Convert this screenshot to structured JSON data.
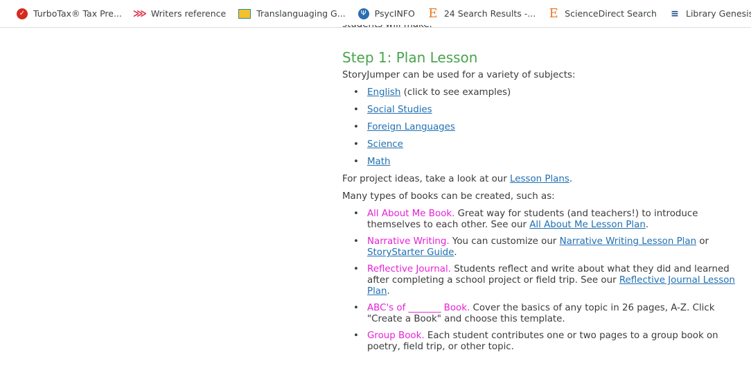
{
  "bookmarks": [
    {
      "label": "TurboTax® Tax Pre...",
      "icon": "turbotax-icon"
    },
    {
      "label": "Writers reference",
      "icon": "writers-reference-icon"
    },
    {
      "label": "Translanguaging G...",
      "icon": "translanguaging-icon"
    },
    {
      "label": "PsycINFO",
      "icon": "psycinfo-icon"
    },
    {
      "label": "24 Search Results -...",
      "icon": "ebsco-e-icon"
    },
    {
      "label": "ScienceDirect Search",
      "icon": "ebsco-e-icon"
    },
    {
      "label": "Library Genesis",
      "icon": "library-genesis-icon"
    }
  ],
  "page": {
    "cut_text": "students will make.",
    "heading": "Step 1: Plan Lesson",
    "intro": "StoryJumper can be used for a variety of subjects:",
    "subjects": [
      {
        "link": "English",
        "suffix": " (click to see examples)"
      },
      {
        "link": "Social Studies",
        "suffix": ""
      },
      {
        "link": "Foreign Languages",
        "suffix": ""
      },
      {
        "link": "Science",
        "suffix": ""
      },
      {
        "link": "Math",
        "suffix": ""
      }
    ],
    "project_ideas_prefix": "For project ideas, take a look at our ",
    "project_ideas_link": "Lesson Plans",
    "project_ideas_suffix": ".",
    "types_intro": "Many types of books can be created, such as:",
    "book_types": {
      "all_about_me": {
        "title": "All About Me Book.",
        "text": " Great way for students (and teachers!) to introduce themselves to each other. See our ",
        "link": "All About Me Lesson Plan",
        "end": "."
      },
      "narrative": {
        "title": "Narrative Writing.",
        "text": " You can customize our ",
        "link1": "Narrative Writing Lesson Plan",
        "mid": " or ",
        "link2": "StoryStarter Guide",
        "end": "."
      },
      "reflective": {
        "title": "Reflective Journal.",
        "text": " Students reflect and write about what they did and learned after completing a school project or field trip. See our ",
        "link": "Reflective Journal Lesson Plan",
        "end": "."
      },
      "abc": {
        "title": "ABC's of _______ Book.",
        "text": " Cover the basics of any topic in 26 pages, A-Z. Click \"Create a Book\" and choose this template."
      },
      "group": {
        "title": "Group Book.",
        "text": " Each student contributes one or two pages to a group book on poetry, field trip, or other topic."
      }
    }
  }
}
